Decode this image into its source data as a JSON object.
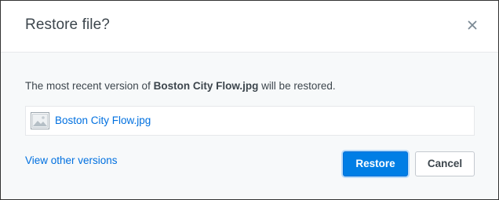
{
  "dialog": {
    "title": "Restore file?",
    "message_prefix": "The most recent version of ",
    "message_filename": "Boston City Flow.jpg",
    "message_suffix": " will be restored.",
    "file": {
      "name": "Boston City Flow.jpg",
      "thumbnail_icon": "image-file-icon"
    },
    "other_versions_link": "View other versions",
    "buttons": {
      "restore": "Restore",
      "cancel": "Cancel"
    },
    "close_icon": "close-icon",
    "colors": {
      "accent": "#007ee5",
      "link": "#0070e0",
      "text": "#3d464d",
      "footer_bg": "#f7f9fa"
    }
  }
}
